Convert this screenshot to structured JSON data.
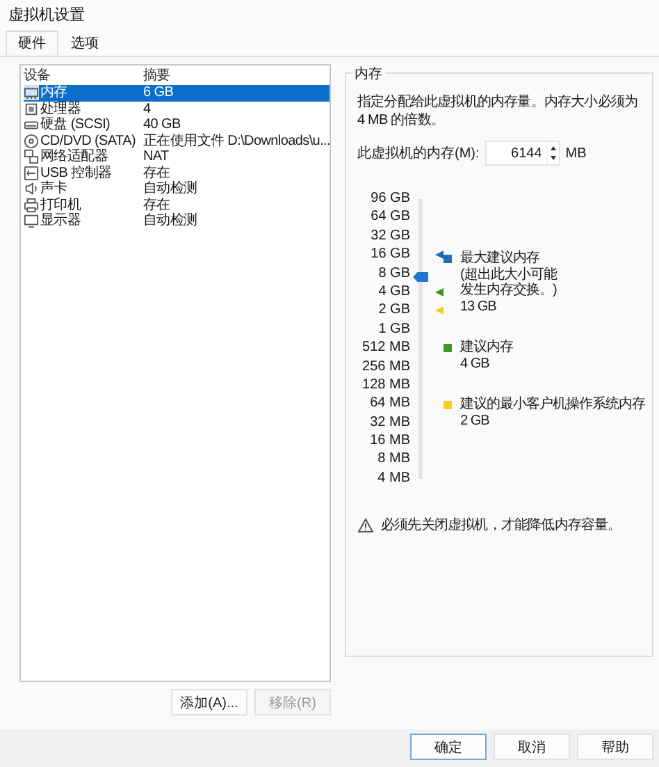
{
  "window": {
    "title": "虚拟机设置"
  },
  "tabs": [
    {
      "label": "硬件",
      "selected": true
    },
    {
      "label": "选项",
      "selected": false
    }
  ],
  "devices": {
    "columns": [
      "设备",
      "摘要"
    ],
    "rows": [
      {
        "kind": "memory",
        "device": "内存",
        "summary": "6 GB",
        "selected": true
      },
      {
        "kind": "cpu",
        "device": "处理器",
        "summary": "4",
        "selected": false
      },
      {
        "kind": "disk",
        "device": "硬盘 (SCSI)",
        "summary": "40 GB",
        "selected": false
      },
      {
        "kind": "optical",
        "device": "CD/DVD (SATA)",
        "summary": "正在使用文件 D:\\Downloads\\u...",
        "selected": false
      },
      {
        "kind": "network",
        "device": "网络适配器",
        "summary": "NAT",
        "selected": false
      },
      {
        "kind": "usb",
        "device": "USB 控制器",
        "summary": "存在",
        "selected": false
      },
      {
        "kind": "sound",
        "device": "声卡",
        "summary": "自动检测",
        "selected": false
      },
      {
        "kind": "printer",
        "device": "打印机",
        "summary": "存在",
        "selected": false
      },
      {
        "kind": "display",
        "device": "显示器",
        "summary": "自动检测",
        "selected": false
      }
    ],
    "buttons": [
      {
        "label": "添加(A)...",
        "disabled": false
      },
      {
        "label": "移除(R)",
        "disabled": true
      }
    ]
  },
  "memory": {
    "title": "内存",
    "description": "指定分配给此虚拟机的内存量。内存大小必须为 4 MB 的倍数。",
    "field_label": "此虚拟机的内存(M):",
    "value": "6144",
    "unit": "MB",
    "scale": [
      "96 GB",
      "64 GB",
      "32 GB",
      "16 GB",
      "8 GB",
      "4 GB",
      "2 GB",
      "1 GB",
      "512 MB",
      "256 MB",
      "128 MB",
      "64 MB",
      "32 MB",
      "16 MB",
      "8 MB",
      "4 MB"
    ],
    "level": 0.72,
    "markers": [
      {
        "color": "#1e6fb5",
        "level": 0.8
      },
      {
        "color": "#3c9a1e",
        "level": 0.667
      },
      {
        "color": "#f2d21c",
        "level": 0.6
      }
    ],
    "legend": [
      {
        "label": "最大建议内存",
        "note": "(超出此大小可能发生内存交换。)",
        "value": "13 GB",
        "color": "#1e6fb5"
      },
      {
        "label": "建议内存",
        "value": "4 GB",
        "color": "#3c9a1e"
      },
      {
        "label": "建议的最小客户机操作系统内存",
        "value": "2 GB",
        "color": "#f2d21c"
      }
    ],
    "warning": "必须先关闭虚拟机，才能降低内存容量。"
  },
  "footer": [
    {
      "label": "确定",
      "default": true
    },
    {
      "label": "取消",
      "default": false
    },
    {
      "label": "帮助",
      "default": false
    }
  ]
}
